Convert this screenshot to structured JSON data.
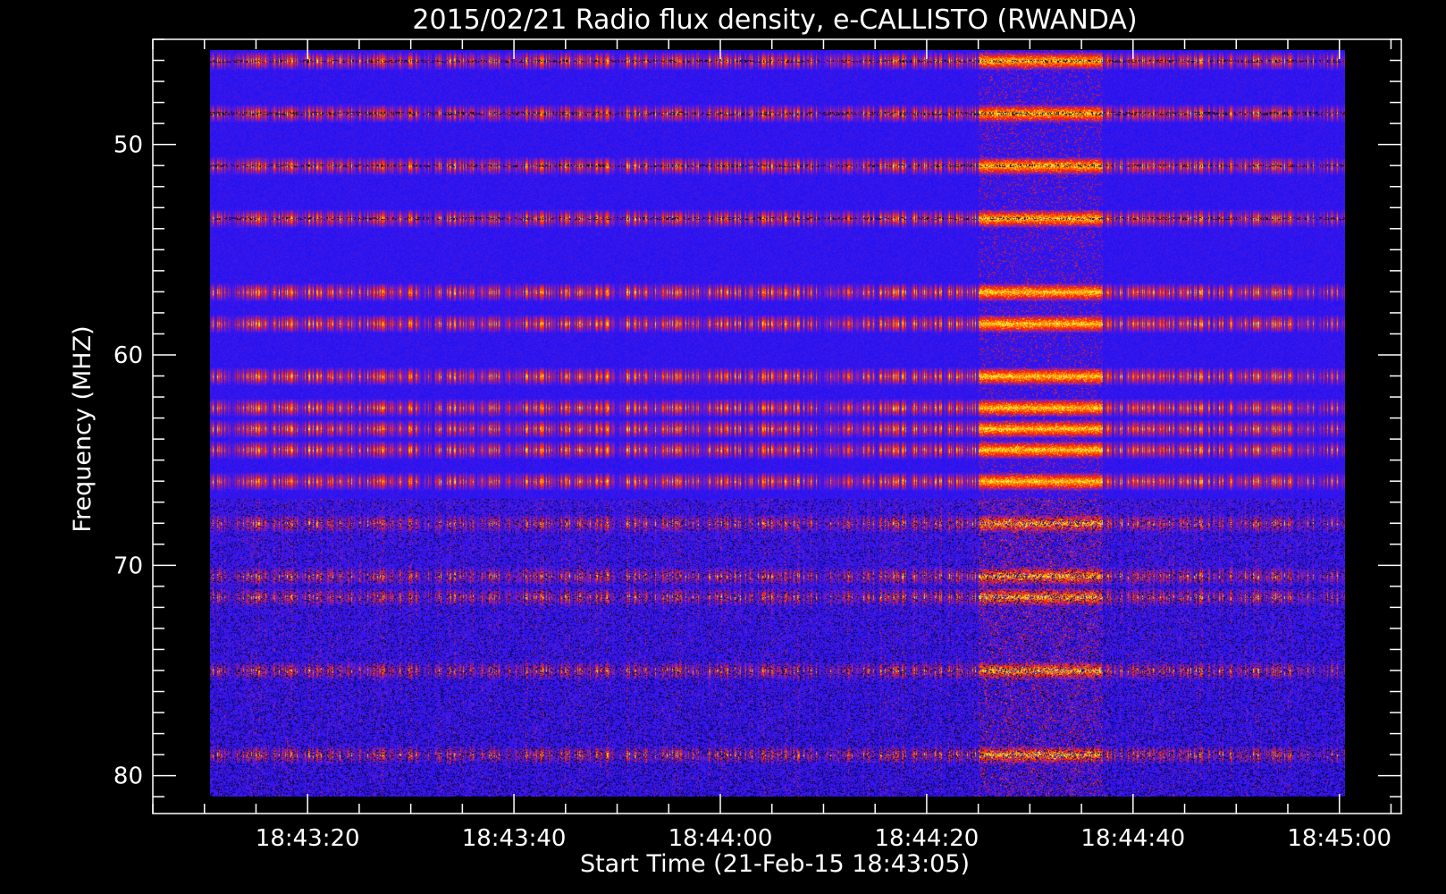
{
  "chart_data": {
    "type": "heatmap",
    "title": "2015/02/21  Radio flux density, e-CALLISTO (RWANDA)",
    "xlabel": "Start Time (21-Feb-15 18:43:05)",
    "ylabel": "Frequency (MHZ)",
    "x_ticks": [
      "18:43:20",
      "18:43:40",
      "18:44:00",
      "18:44:20",
      "18:44:40",
      "18:45:00"
    ],
    "x_tick_seconds": [
      15,
      35,
      55,
      75,
      95,
      115
    ],
    "xlim_seconds": [
      0,
      121
    ],
    "y_ticks": [
      "50",
      "60",
      "70",
      "80"
    ],
    "y_tick_values": [
      50,
      60,
      70,
      80
    ],
    "ylim": [
      45,
      81.8
    ],
    "y_inverted": true,
    "data_extent": {
      "time_seconds": [
        5.5,
        115.5
      ],
      "frequency_mhz": [
        45.5,
        81
      ]
    },
    "bright_bands_mhz": [
      46,
      48.5,
      51,
      53.5,
      57,
      58.5,
      61,
      62.5,
      63.5,
      64.5,
      66,
      68,
      70.5,
      71.5,
      75,
      79
    ],
    "burst_interval_seconds": [
      80,
      92
    ],
    "colormap": [
      "#000000",
      "#1010ff",
      "#8020c0",
      "#ff2000",
      "#ff8000",
      "#ffff40"
    ],
    "frame_color": "#ffffff",
    "background": "#000000"
  }
}
